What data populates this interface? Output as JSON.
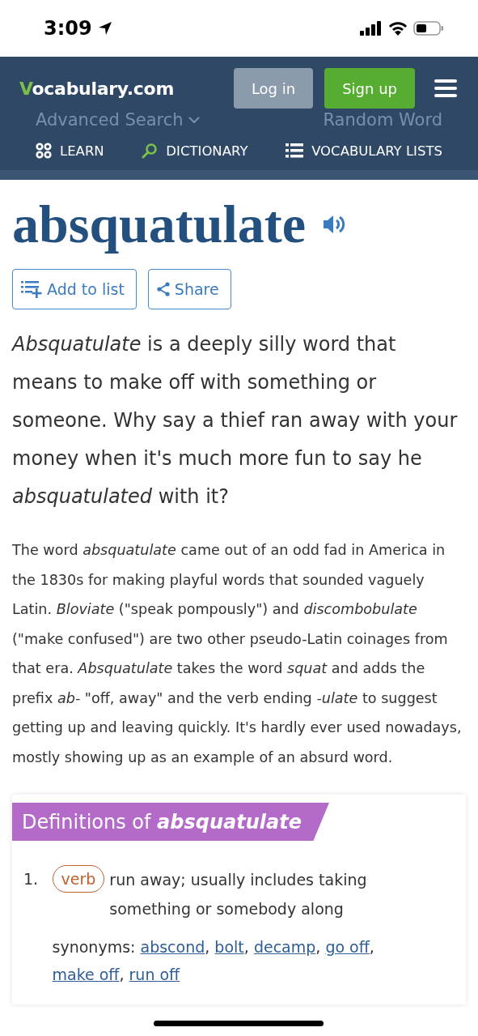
{
  "status_bar": {
    "time": "3:09"
  },
  "header": {
    "logo": "Vocabulary.com",
    "ghost_search": {
      "advanced": "Advanced Search",
      "random": "Random Word"
    },
    "buttons": [
      {
        "label": "Log in",
        "kind": "secondary"
      },
      {
        "label": "Sign up",
        "kind": "primary"
      }
    ],
    "nav": [
      {
        "label": "LEARN",
        "kind": "learn"
      },
      {
        "label": "DICTIONARY",
        "kind": "dictionary"
      },
      {
        "label": "VOCABULARY LISTS",
        "kind": "lists"
      }
    ]
  },
  "word": "absquatulate",
  "actions": [
    {
      "label": "Add to list",
      "kind": "add"
    },
    {
      "label": "Share",
      "kind": "share"
    }
  ],
  "short_blurb": "*Absquatulate* is a deeply silly word that means to make off with something or someone. Why say a thief ran away with your money when it's much more fun to say he *absquatulated* with it?",
  "long_blurb": "The word *absquatulate* came out of an odd fad in America in the 1830s for making playful words that sounded vaguely Latin. *Bloviate* (\"speak pompously\") and *discombobulate* (\"make confused\") are two other pseudo-Latin coinages from that era. *Absquatulate* takes the word *squat* and adds the prefix *ab-* \"off, away\" and the verb ending *-ulate* to suggest getting up and leaving quickly. It's hardly ever used nowadays, mostly showing up as an example of an absurd word.",
  "definitions": {
    "title": "Definitions of",
    "word": "absquatulate",
    "items": [
      {
        "number": "1.",
        "pos": "verb",
        "text": "run away; usually includes taking something or somebody along",
        "synonyms_label": "synonyms:",
        "separator": ",",
        "synonyms": [
          "abscond",
          "bolt",
          "decamp",
          "go off",
          "make off",
          "run off"
        ]
      }
    ]
  }
}
